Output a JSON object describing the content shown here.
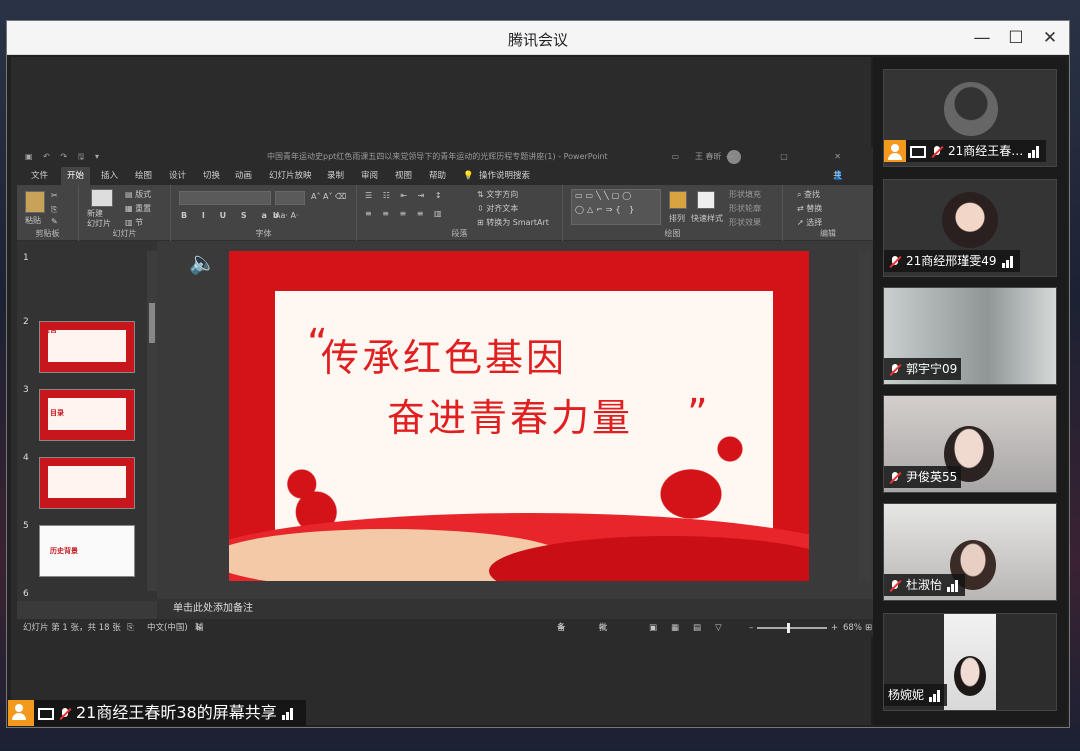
{
  "window": {
    "title": "腾讯会议",
    "minimize": "—",
    "maximize": "☐",
    "close": "✕"
  },
  "ppt": {
    "quick_access": "▣ ↶ ↷ 🖫 ▾",
    "doc_title": "中国青年运动史ppt红色雨课五四以来党领导下的青年运动的光辉历程专题讲座(1)  -  PowerPoint",
    "user": "王 春昕",
    "window_controls": "▭ — ▢ ✕",
    "tabs": [
      "文件",
      "开始",
      "插入",
      "绘图",
      "设计",
      "切换",
      "动画",
      "幻灯片放映",
      "录制",
      "审阅",
      "视图",
      "帮助",
      "操作说明搜索"
    ],
    "share_label": "共享",
    "ribbon": {
      "groups": [
        "剪贴板",
        "幻灯片",
        "字体",
        "段落",
        "绘图",
        "编辑"
      ],
      "paste": "粘贴",
      "new_slide": "新建\n幻灯片",
      "layout": "版式",
      "reset": "重置",
      "section": "节",
      "text_direction": "文字方向",
      "align_text": "对齐文本",
      "smartart": "转换为 SmartArt",
      "arrange": "排列",
      "quick_styles": "快速样式",
      "shape_fill": "形状填充",
      "shape_outline": "形状轮廓",
      "shape_effects": "形状效果",
      "find": "查找",
      "replace": "替换",
      "select": "选择"
    },
    "thumbnails": [
      {
        "num": "1",
        "label": ""
      },
      {
        "num": "2",
        "label": "前言"
      },
      {
        "num": "3",
        "label": "目录"
      },
      {
        "num": "4",
        "label": ""
      },
      {
        "num": "5",
        "label": "历史背景"
      },
      {
        "num": "6",
        "label": ""
      }
    ],
    "slide": {
      "line1": "传承红色基因",
      "line2": "奋进青春力量",
      "quote_open": "“",
      "quote_close": "”"
    },
    "notes_placeholder": "单击此处添加备注",
    "status": {
      "slide_count": "幻灯片 第 1 张，共 18 张",
      "language": "中文(中国)",
      "accessibility": "辅助功能: 调查",
      "notes": "备注",
      "comments": "批注",
      "zoom": "68%"
    }
  },
  "participants": [
    {
      "name": "21商经王春…",
      "host": true
    },
    {
      "name": "21商经邢瑾雯49",
      "host": false
    },
    {
      "name": "郭宇宁09",
      "host": false
    },
    {
      "name": "尹俊英55",
      "host": false
    },
    {
      "name": "杜淑怡",
      "host": false
    },
    {
      "name": "杨婉妮",
      "host": false
    }
  ],
  "screen_share_label": "21商经王春昕38的屏幕共享",
  "colors": {
    "slide_red": "#d31318",
    "host_orange": "#f39a1e"
  }
}
